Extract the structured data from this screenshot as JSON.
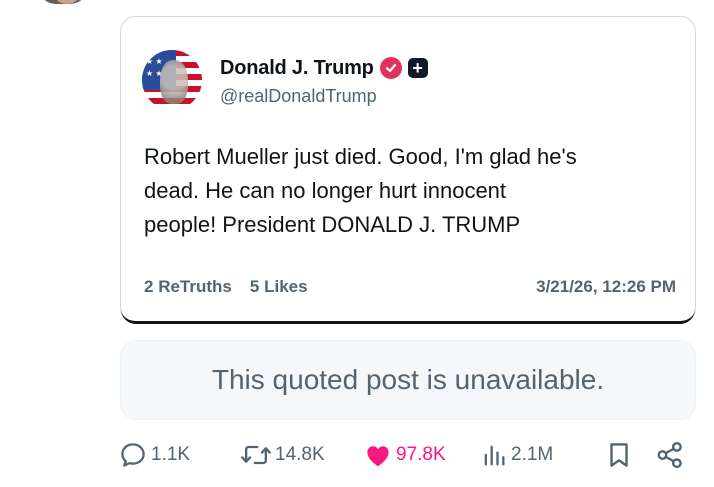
{
  "quoted_truth": {
    "display_name": "Donald J. Trump",
    "handle": "@realDonaldTrump",
    "body_lines": [
      "Robert Mueller just died. Good, I'm glad he's",
      "dead. He can no longer hurt innocent",
      "people! President DONALD J. TRUMP"
    ],
    "retruths_count": "2",
    "retruths_label": "ReTruths",
    "likes_count": "5",
    "likes_label": "Likes",
    "timestamp": "3/21/26, 12:26 PM",
    "verified_badge_color": "#e0325d"
  },
  "unavailable_notice": "This quoted post is unavailable.",
  "actions": {
    "replies": "1.1K",
    "reposts": "14.8K",
    "likes": "97.8K",
    "views": "2.1M",
    "like_color": "#f91880",
    "icons": [
      "reply-icon",
      "repost-icon",
      "heart-icon",
      "views-icon",
      "bookmark-icon",
      "share-icon"
    ]
  }
}
